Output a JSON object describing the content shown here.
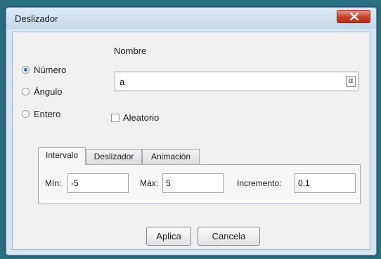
{
  "window": {
    "title": "Deslizador"
  },
  "type_options": [
    {
      "label": "Número",
      "checked": true
    },
    {
      "label": "Ángulo",
      "checked": false
    },
    {
      "label": "Entero",
      "checked": false
    }
  ],
  "name": {
    "label": "Nombre",
    "value": "a",
    "symbol_button": "α"
  },
  "random": {
    "label": "Aleatorio",
    "checked": false
  },
  "tabs": [
    {
      "label": "Intervalo",
      "active": true
    },
    {
      "label": "Deslizador",
      "active": false
    },
    {
      "label": "Animación",
      "active": false
    }
  ],
  "interval": {
    "min_label": "Mín:",
    "min_value": "-5",
    "max_label": "Máx:",
    "max_value": "5",
    "increment_label": "Incremento:",
    "increment_value": "0.1"
  },
  "buttons": {
    "apply": "Aplica",
    "cancel": "Cancela"
  },
  "colors": {
    "accent": "#3a6fb0",
    "close_button": "#c7412a",
    "desktop": "#2a6e82"
  }
}
